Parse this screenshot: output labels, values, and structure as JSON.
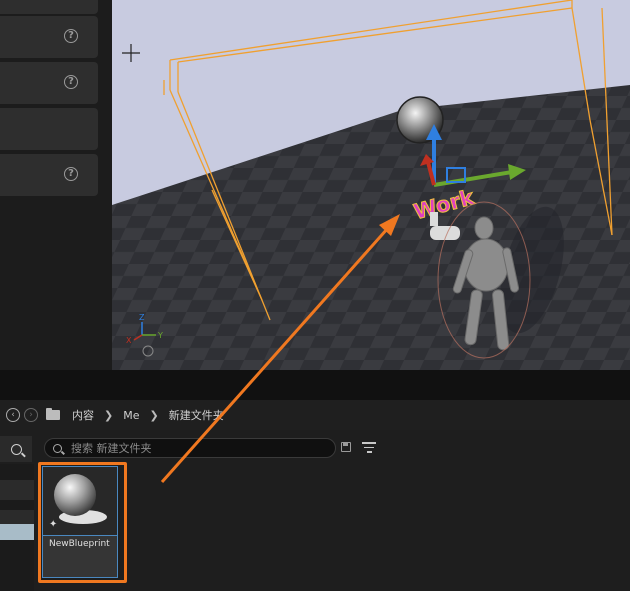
{
  "breadcrumb": {
    "items": [
      "内容",
      "Me",
      "新建文件夹"
    ]
  },
  "search": {
    "placeholder": "搜索 新建文件夹"
  },
  "asset": {
    "name": "NewBlueprint"
  },
  "detail_rows": [
    {
      "help": "?"
    },
    {
      "help": "?"
    },
    {
      "help": ""
    },
    {
      "help": "?"
    }
  ],
  "colors": {
    "highlight": "#f07820",
    "viewport_sky": "#c8cbe0",
    "bounding_lines": "#f0a030",
    "selection_blue": "#4a88c0"
  },
  "viewport": {
    "overlay_text": "Work"
  }
}
